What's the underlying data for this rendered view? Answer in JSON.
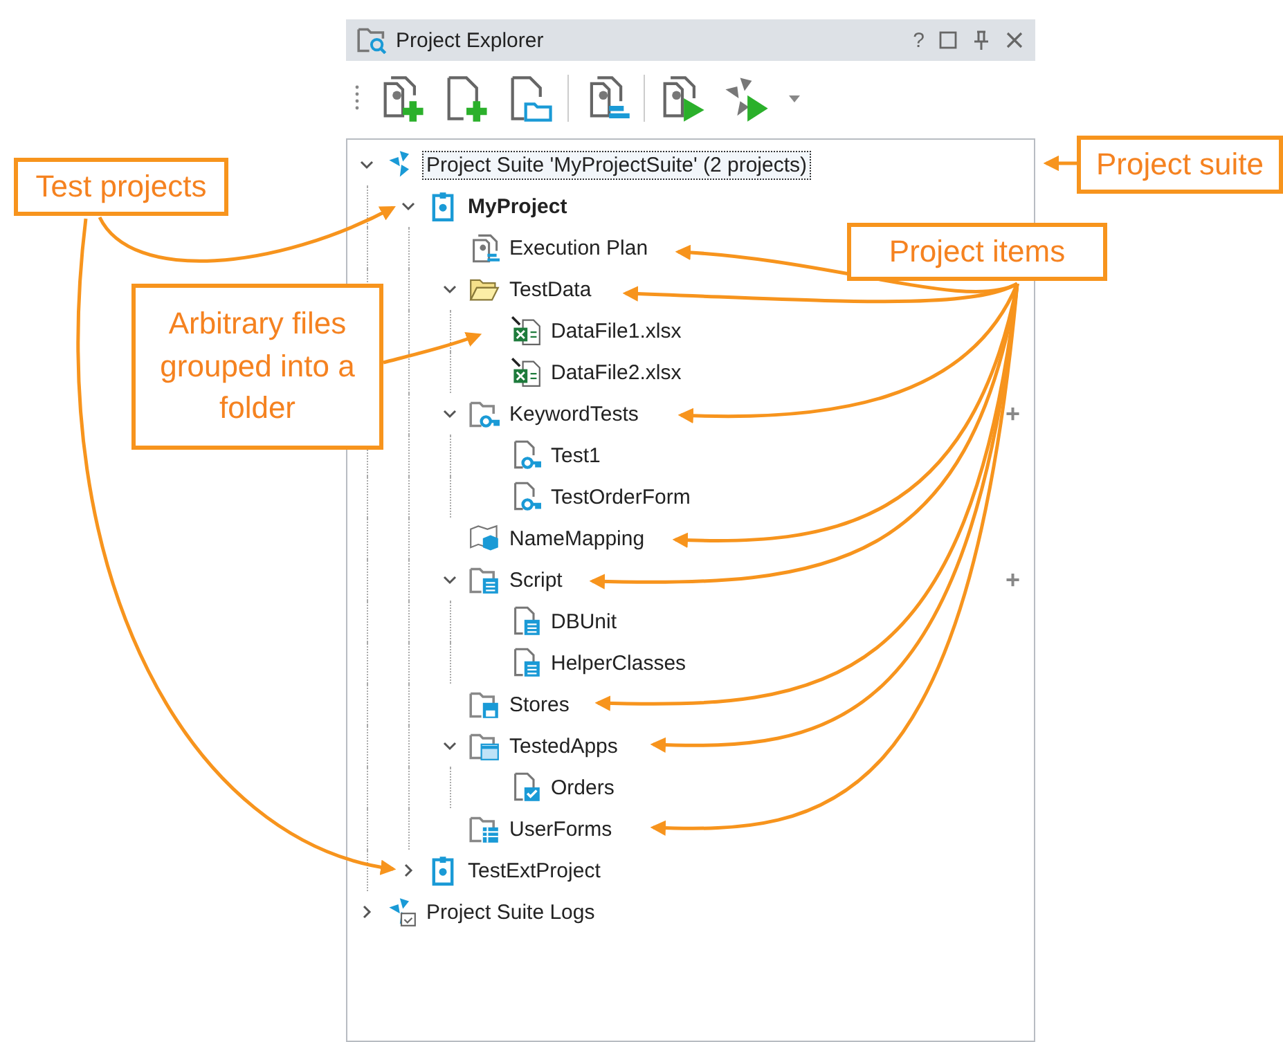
{
  "panel": {
    "title": "Project Explorer",
    "help_label": "?"
  },
  "tree": [
    {
      "label": "Project Suite 'MyProjectSuite' (2 projects)",
      "kind": "suite",
      "expanded": true,
      "focused": true,
      "children": [
        {
          "label": "MyProject",
          "kind": "project",
          "expanded": true,
          "bold": true,
          "children": [
            {
              "label": "Execution Plan",
              "kind": "plan"
            },
            {
              "label": "TestData",
              "kind": "folder-open",
              "expanded": true,
              "children": [
                {
                  "label": "DataFile1.xlsx",
                  "kind": "excel"
                },
                {
                  "label": "DataFile2.xlsx",
                  "kind": "excel"
                }
              ]
            },
            {
              "label": "KeywordTests",
              "kind": "key-folder",
              "expanded": true,
              "side_mark": "+",
              "children": [
                {
                  "label": "Test1",
                  "kind": "key-file"
                },
                {
                  "label": "TestOrderForm",
                  "kind": "key-file"
                }
              ]
            },
            {
              "label": "NameMapping",
              "kind": "map"
            },
            {
              "label": "Script",
              "kind": "script-folder",
              "expanded": true,
              "side_mark": "+",
              "children": [
                {
                  "label": "DBUnit",
                  "kind": "script-file"
                },
                {
                  "label": "HelperClasses",
                  "kind": "script-file"
                }
              ]
            },
            {
              "label": "Stores",
              "kind": "stores"
            },
            {
              "label": "TestedApps",
              "kind": "apps-folder",
              "expanded": true,
              "children": [
                {
                  "label": "Orders",
                  "kind": "app"
                }
              ]
            },
            {
              "label": "UserForms",
              "kind": "forms"
            }
          ]
        },
        {
          "label": "TestExtProject",
          "kind": "project",
          "expanded": false
        }
      ]
    },
    {
      "label": "Project Suite Logs",
      "kind": "logs",
      "expanded": false
    }
  ],
  "callouts": [
    {
      "text": "Project suite"
    },
    {
      "text": "Test projects"
    },
    {
      "text": "Project items"
    },
    {
      "text": "Arbitrary files grouped into a folder"
    }
  ]
}
